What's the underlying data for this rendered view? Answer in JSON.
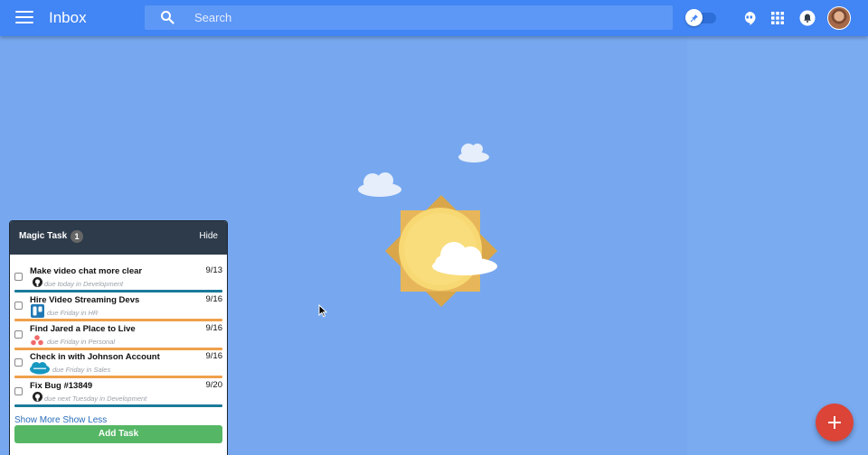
{
  "header": {
    "title": "Inbox",
    "search_placeholder": "Search"
  },
  "icons": {
    "menu": "menu-icon",
    "search": "search-icon",
    "pin": "pin-icon",
    "hangouts": "hangouts-icon",
    "apps": "apps-grid-icon",
    "notifications": "notifications-icon",
    "compose": "plus-icon"
  },
  "colors": {
    "topbar": "#4285f4",
    "background": "#77a8ef",
    "panel_header": "#2e3b4b",
    "add_task": "#55b765",
    "fab": "#db4437",
    "bar_teal": "#1a7a99",
    "bar_orange": "#f0a04b"
  },
  "magic_task": {
    "title": "Magic Task",
    "count": "1",
    "hide_label": "Hide",
    "tasks": [
      {
        "title": "Make video chat more clear",
        "date": "9/13",
        "meta": "due today in Development",
        "source_icon": "github-icon",
        "bar": "#1a7a99"
      },
      {
        "title": "Hire Video Streaming Devs",
        "date": "9/16",
        "meta": "due Friday in HR",
        "source_icon": "trello-icon",
        "bar": "#f0a04b"
      },
      {
        "title": "Find Jared a Place to Live",
        "date": "9/16",
        "meta": "due Friday in Personal",
        "source_icon": "asana-icon",
        "bar": "#f0a04b"
      },
      {
        "title": "Check in with Johnson Account",
        "date": "9/16",
        "meta": "due Friday in Sales",
        "source_icon": "salesforce-icon",
        "bar": "#f0a04b"
      },
      {
        "title": "Fix Bug #13849",
        "date": "9/20",
        "meta": "due next Tuesday in Development",
        "source_icon": "github-icon",
        "bar": "#1a7a99"
      }
    ],
    "show_more": "Show More",
    "show_less": "Show Less",
    "add_task_label": "Add Task"
  }
}
